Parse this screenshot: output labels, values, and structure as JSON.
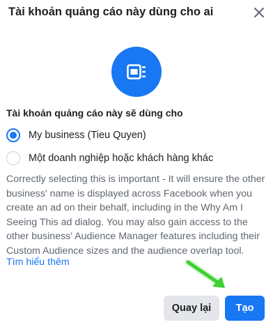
{
  "dialog": {
    "title": "Tài khoản quảng cáo này dùng cho ai",
    "close_icon": "close-icon",
    "hero_icon": "ad-account-icon",
    "accent_color": "#1877f2"
  },
  "usage": {
    "heading": "Tài khoản quảng cáo này sẽ dùng cho",
    "options": [
      {
        "label": "My business (Tieu Quyen)",
        "selected": true
      },
      {
        "label": "Một doanh nghiệp hoặc khách hàng khác",
        "selected": false
      }
    ]
  },
  "info": {
    "description": "Correctly selecting this is important - It will ensure the other business' name is displayed across Facebook when you create an ad on their behalf, including in the Why Am I Seeing This ad dialog. You may also gain access to the other business' Audience Manager features including their Custom Audience sizes and the audience overlap tool.",
    "learn_more": "Tìm hiểu thêm"
  },
  "footer": {
    "back_label": "Quay lại",
    "create_label": "Tạo"
  },
  "annotation": {
    "arrow_icon": "green-arrow-icon",
    "arrow_color": "#3bd12e"
  }
}
